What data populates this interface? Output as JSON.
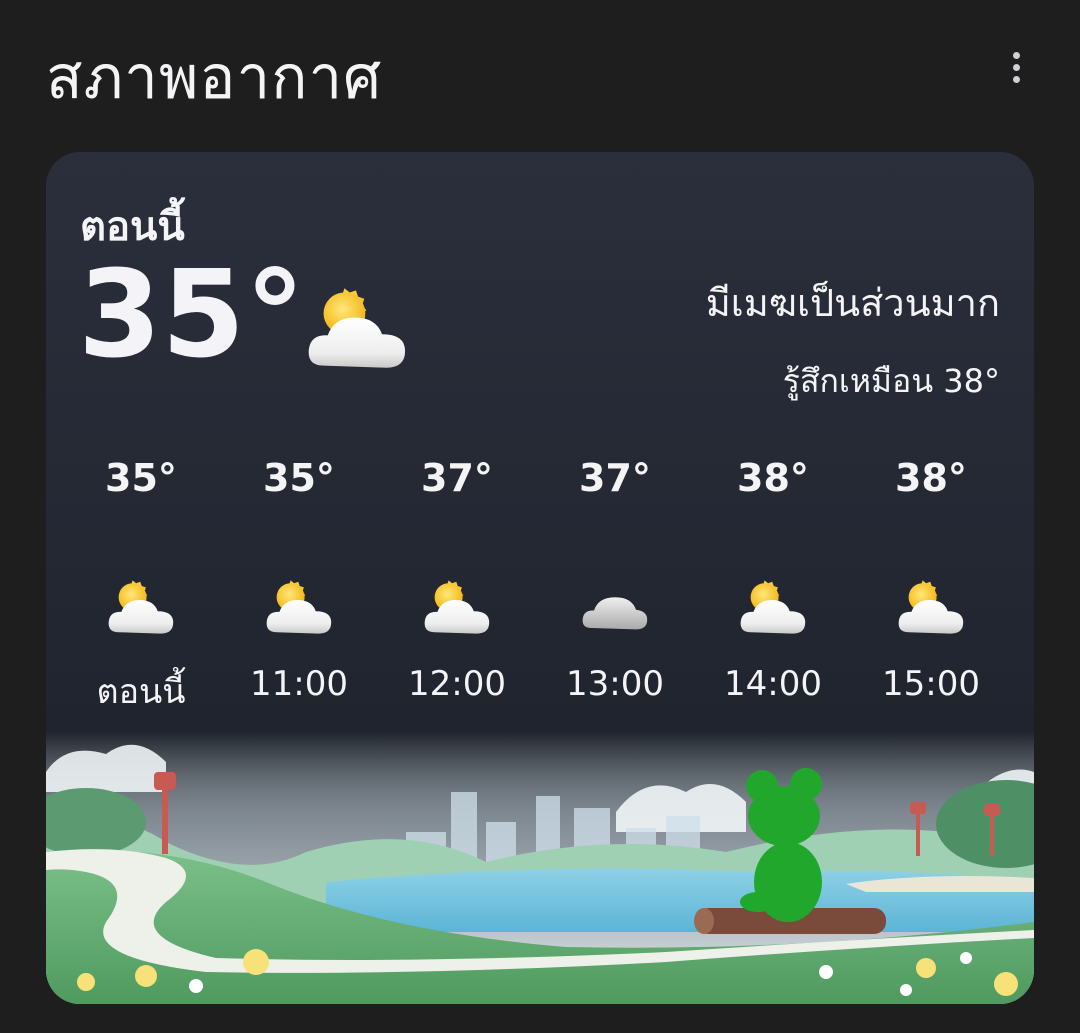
{
  "header": {
    "title": "สภาพอากาศ",
    "menu_icon": "more-vert-icon"
  },
  "current": {
    "label": "ตอนนี้",
    "temp": "35°",
    "condition": "มีเมฆเป็นส่วนมาก",
    "feels_like": "รู้สึกเหมือน 38°",
    "icon": "partly-cloudy-icon"
  },
  "hourly": [
    {
      "temp": "35°",
      "time": "ตอนนี้",
      "icon": "partly-cloudy-icon"
    },
    {
      "temp": "35°",
      "time": "11:00",
      "icon": "partly-cloudy-icon"
    },
    {
      "temp": "37°",
      "time": "12:00",
      "icon": "partly-cloudy-icon"
    },
    {
      "temp": "37°",
      "time": "13:00",
      "icon": "cloudy-icon"
    },
    {
      "temp": "38°",
      "time": "14:00",
      "icon": "partly-cloudy-icon"
    },
    {
      "temp": "38°",
      "time": "15:00",
      "icon": "partly-cloudy-icon"
    }
  ],
  "colors": {
    "background": "#1e1e1f",
    "card": "#262a35",
    "sun": "#f5c72b",
    "cloud": "#f2f2f2",
    "frog": "#1fa52a"
  }
}
